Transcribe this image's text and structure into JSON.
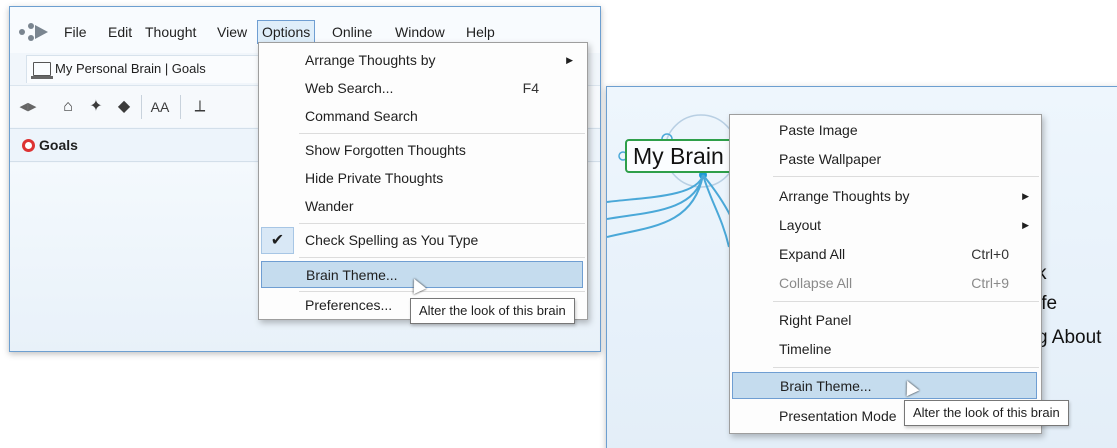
{
  "left_window": {
    "menu": [
      "File",
      "Edit",
      "Thought",
      "View",
      "Options",
      "Online",
      "Window",
      "Help"
    ],
    "active_menu": "Options",
    "tab_title": "My Personal Brain | Goals",
    "crumb": "Goals",
    "font_button": "AA",
    "options_menu": {
      "items": [
        {
          "label": "Arrange Thoughts by",
          "submenu": true
        },
        {
          "label": "Web Search...",
          "shortcut": "F4"
        },
        {
          "label": "Command Search"
        },
        {
          "label": "Show Forgotten Thoughts"
        },
        {
          "label": "Hide Private Thoughts"
        },
        {
          "label": "Wander"
        },
        {
          "label": "Check Spelling as You Type",
          "checked": true
        },
        {
          "label": "Brain Theme...",
          "highlighted": true
        },
        {
          "label": "Preferences..."
        }
      ],
      "tooltip": "Alter the look of this brain"
    }
  },
  "right_window": {
    "node_label": "My Brain",
    "partial_labels": [
      "k",
      "ife",
      "g About"
    ],
    "context_menu": {
      "items": [
        {
          "label": "Paste Image"
        },
        {
          "label": "Paste Wallpaper"
        },
        {
          "label": "Arrange Thoughts by",
          "submenu": true
        },
        {
          "label": "Layout",
          "submenu": true
        },
        {
          "label": "Expand All",
          "shortcut": "Ctrl+0"
        },
        {
          "label": "Collapse All",
          "shortcut": "Ctrl+9",
          "disabled": true
        },
        {
          "label": "Right Panel"
        },
        {
          "label": "Timeline"
        },
        {
          "label": "Brain Theme...",
          "highlighted": true
        },
        {
          "label": "Presentation Mode"
        }
      ],
      "tooltip": "Alter the look of this brain"
    }
  },
  "colors": {
    "accent": "#6f9ed2",
    "highlight": "#c5dcee",
    "node_border": "#2e9f4a",
    "link": "#4aa8d8"
  }
}
